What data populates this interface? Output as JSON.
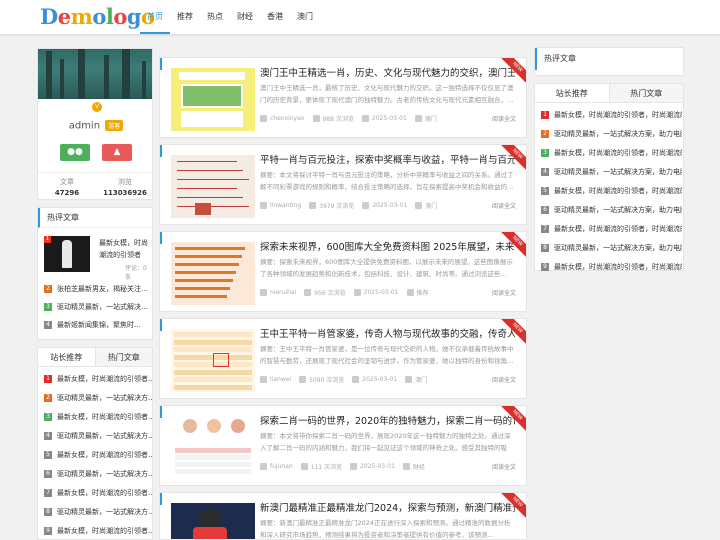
{
  "header": {
    "logo": [
      "D",
      "e",
      "m",
      "o",
      "l",
      "o",
      "g",
      "o"
    ],
    "logo_colors": [
      "#3b8fd6",
      "#e8443a",
      "#f0a800",
      "#3b8fd6",
      "#4cb05a",
      "#e8443a",
      "#3b8fd6",
      "#f0a800"
    ],
    "nav": [
      "首页",
      "推荐",
      "热点",
      "财经",
      "香港",
      "澳门"
    ]
  },
  "profile": {
    "name": "admin",
    "badge": "游客",
    "avatar_badge": "V",
    "wechat_icon": "wechat-icon",
    "weibo_icon": "bell-icon",
    "stats": [
      {
        "label": "文章",
        "value": "47296"
      },
      {
        "label": "浏览",
        "value": "113036926"
      }
    ]
  },
  "left_hot": {
    "title": "热评文章",
    "top_item": {
      "num": "1",
      "title": "最新女模，时尚潮流的引领者",
      "meta": "评论：0 条"
    },
    "items": [
      {
        "num": "2",
        "text": "张柏芝最新男友，揭秘关注…",
        "color": "#e86c1f"
      },
      {
        "num": "3",
        "text": "驱动精灵最新，一站式解决…",
        "color": "#4cb05a"
      },
      {
        "num": "4",
        "text": "最新姬新闻集锦，聚焦时…",
        "color": "#888888"
      }
    ]
  },
  "left_rec": {
    "tabs": [
      "站长推荐",
      "热门文章"
    ],
    "items": [
      {
        "num": "1",
        "text": "最新女模，时尚潮流的引领者…",
        "color": "#e32b2b"
      },
      {
        "num": "2",
        "text": "驱动精灵最新，一站式解决方…",
        "color": "#e86c1f"
      },
      {
        "num": "3",
        "text": "最新女模，时尚潮流的引领者…",
        "color": "#4cb05a"
      },
      {
        "num": "4",
        "text": "驱动精灵最新，一站式解决方…",
        "color": "#888888"
      },
      {
        "num": "5",
        "text": "最新女模，时尚潮流的引领者…",
        "color": "#888888"
      },
      {
        "num": "6",
        "text": "驱动精灵最新，一站式解决方…",
        "color": "#888888"
      },
      {
        "num": "7",
        "text": "最新女模，时尚潮流的引领者…",
        "color": "#888888"
      },
      {
        "num": "8",
        "text": "驱动精灵最新，一站式解决方…",
        "color": "#888888"
      },
      {
        "num": "9",
        "text": "最新女模，时尚潮流的引领者…",
        "color": "#888888"
      }
    ]
  },
  "posts": [
    {
      "title": "澳门王中王精选一肖，历史、文化与现代魅力的交织，澳门王…",
      "excerpt": "澳门王中王精选一肖，最核了历史、文化与现代魅力的交织。这一独特选择不仅仅显了澳门的历史背景，更体现了现代澳门的独特魅力。古老的传统文化与现代元素相互融合，…",
      "author": "chenxinyao",
      "views": "988 次浏览",
      "date": "2025-03-01",
      "category": "澳门",
      "read": "阅读全文",
      "ribbon": "NEW",
      "thumb": "yellow"
    },
    {
      "title": "平特一肖与百元投注，探索中奖概率与收益，平特一肖与百元…",
      "excerpt": "摘要：本文将探讨平特一肖与百元投注的策略，分析中奖概率与收益之间的关系。通过了解不同彩票游戏的规则和概率，结合投注策略的选择，旨在探索提高中奖机会和收益的…",
      "author": "linwanting",
      "views": "3979 次浏览",
      "date": "2025-03-01",
      "category": "澳门",
      "read": "阅读全文",
      "ribbon": "NEW",
      "thumb": "paper"
    },
    {
      "title": "探索未来视界，600图库大全免费资料图 2025年展望，未来视…",
      "excerpt": "摘要：探索未来视界，600图库大全提供免费资料图，以展示未来的展望。这些图像展示了各种领域的发展趋势和创新技术，包括科技、设计、建筑、时尚等。通过浏览这些…",
      "author": "nieruihai",
      "views": "956 次浏览",
      "date": "2025-03-01",
      "category": "推荐",
      "read": "阅读全文",
      "ribbon": "NEW",
      "thumb": "orange"
    },
    {
      "title": "王中王平特一肖管家婆，传奇人物与现代故事的交融，传奇人…",
      "excerpt": "摘要：王中王平特一肖管家婆，是一位传奇与现代交织的人物。她不仅承载着传统故事中的智慧与勤劳，还展现了现代社会的坚韧与进步。作为管家婆，她以独特的身份和视角…",
      "author": "lianwei",
      "views": "5090 次浏览",
      "date": "2025-03-01",
      "category": "澳门",
      "read": "阅读全文",
      "ribbon": "NEW",
      "thumb": "table"
    },
    {
      "title": "探索二肖一码的世界，2020年的独特魅力，探索二肖一码的世…",
      "excerpt": "摘要：本文将带你探索二肖一码的世界，展现2020年这一独特魅力的独特之处。通过深入了解二肖一码的内涵和魅力，我们将一起见证这个领域的神奇之处。感受其独特的吸引…",
      "author": "fujunan",
      "views": "111 次浏览",
      "date": "2025-03-01",
      "category": "财经",
      "read": "阅读全文",
      "ribbon": "NEW",
      "thumb": "people"
    },
    {
      "title": "新澳门最精准正最精准龙门2024，探索与预测，新澳门精准预…",
      "excerpt": "摘要：新澳门最精准正最精准龙门2024正在进行深入探索和预测。通过精准的数据分析和深入研究市场趋势，预测结果将为投资者和决策者提供有价值的参考。该预测…",
      "author": "",
      "views": "",
      "date": "",
      "category": "",
      "read": "",
      "ribbon": "NEW",
      "thumb": "pingpong"
    }
  ],
  "right_hot": {
    "title": "热评文章"
  },
  "right_rec": {
    "tabs": [
      "站长推荐",
      "热门文章"
    ],
    "items": [
      {
        "num": "1",
        "text": "最新女模，时尚潮流的引领者，时尚潮流的引…",
        "color": "#e32b2b"
      },
      {
        "num": "2",
        "text": "驱动精灵最新，一站式解决方案，助力电脑维…",
        "color": "#e86c1f"
      },
      {
        "num": "3",
        "text": "最新女模，时尚潮流的引领者，时尚潮流的引…",
        "color": "#4cb05a"
      },
      {
        "num": "4",
        "text": "驱动精灵最新，一站式解决方案，助力电脑维…",
        "color": "#888888"
      },
      {
        "num": "5",
        "text": "最新女模，时尚潮流的引领者，时尚潮流的引…",
        "color": "#888888"
      },
      {
        "num": "6",
        "text": "驱动精灵最新，一站式解决方案，助力电脑维…",
        "color": "#888888"
      },
      {
        "num": "7",
        "text": "最新女模，时尚潮流的引领者，时尚潮流的引…",
        "color": "#888888"
      },
      {
        "num": "8",
        "text": "驱动精灵最新，一站式解决方案，助力电脑维…",
        "color": "#888888"
      },
      {
        "num": "9",
        "text": "最新女模，时尚潮流的引领者，时尚潮流的引…",
        "color": "#888888"
      }
    ]
  }
}
